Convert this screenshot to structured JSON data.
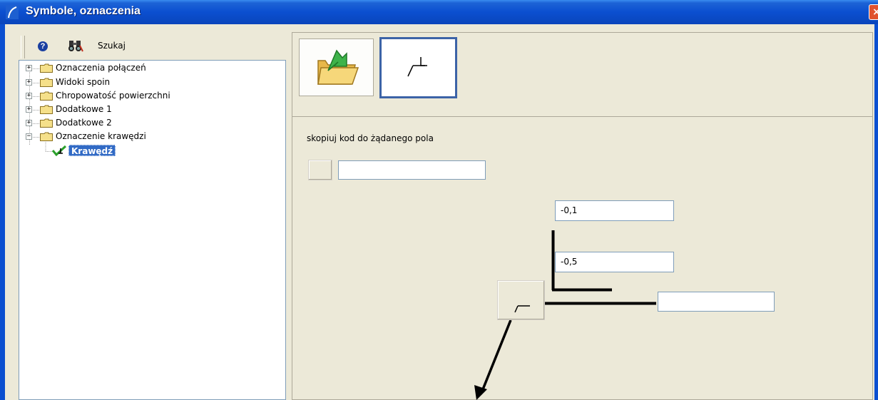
{
  "window": {
    "title": "Symbole, oznaczenia",
    "close_glyph": "×"
  },
  "toolbar": {
    "help_glyph": "?",
    "search_label": "Szukaj",
    "icons": [
      "help-icon",
      "binoculars-icon"
    ]
  },
  "tree": {
    "items": [
      {
        "label": "Oznaczenia połączeń",
        "expander": "+"
      },
      {
        "label": "Widoki spoin",
        "expander": "+"
      },
      {
        "label": "Chropowatość powierzchni",
        "expander": "+"
      },
      {
        "label": "Dodatkowe 1",
        "expander": "+"
      },
      {
        "label": "Dodatkowe 2",
        "expander": "+"
      },
      {
        "label": "Oznaczenie krawędzi",
        "expander": "−"
      }
    ],
    "selected_child": "Krawędź"
  },
  "editor": {
    "hint": "skopiuj kod do żądanego pola",
    "code_value": "",
    "upper_value": "-0,1",
    "lower_value": "-0,5",
    "right_value": ""
  },
  "colors": {
    "titlebar": "#0b4fd0",
    "selection": "#316ac5",
    "active_button_border": "#3c63a7"
  }
}
